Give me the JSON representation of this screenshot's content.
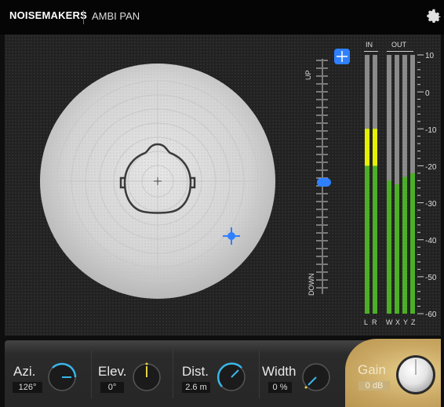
{
  "header": {
    "brand": "NOISEMAKERS",
    "plugin_title": "AMBI PAN",
    "settings_icon": "gear-icon"
  },
  "panner": {
    "center_marker": "+",
    "source_marker_icon": "crosshair-icon"
  },
  "elevation": {
    "up_label": "UP",
    "down_label": "DOWN",
    "level": 0.5
  },
  "meters": {
    "in_label": "IN",
    "out_label": "OUT",
    "channels": [
      "L",
      "R",
      "W",
      "X",
      "Y",
      "Z"
    ],
    "levels_db": [
      -10,
      -10,
      -24,
      -25,
      -23,
      -22
    ],
    "scale": [
      "10",
      "0",
      "-10",
      "-20",
      "-30",
      "-40",
      "-50",
      "-60"
    ],
    "colors": {
      "green": "#4caf27",
      "yellow": "#e6f000"
    }
  },
  "controls": {
    "azimuth": {
      "label": "Azi.",
      "value": "126°"
    },
    "elevation": {
      "label": "Elev.",
      "value": "0°"
    },
    "distance": {
      "label": "Dist.",
      "value": "2.6 m"
    },
    "width": {
      "label": "Width",
      "value": "0 %"
    },
    "gain": {
      "label": "Gain",
      "value": "0 dB"
    }
  },
  "accent": "#2f80ff"
}
